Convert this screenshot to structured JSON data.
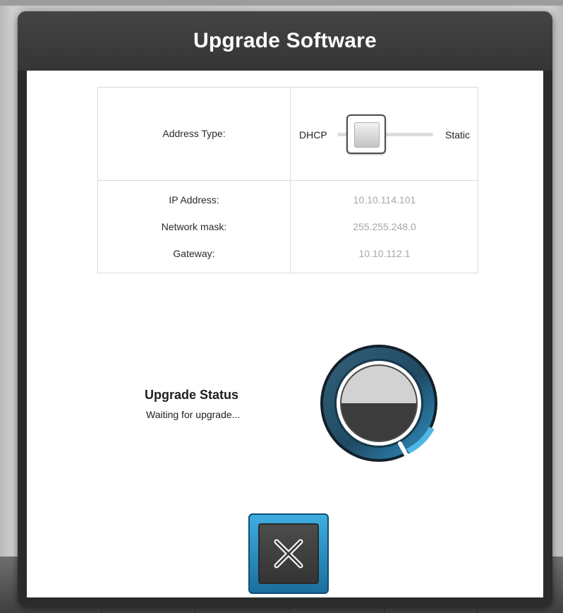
{
  "dialog": {
    "title": "Upgrade Software"
  },
  "network": {
    "address_type_label": "Address Type:",
    "toggle": {
      "left_option": "DHCP",
      "right_option": "Static",
      "selected": "DHCP"
    },
    "rows": [
      {
        "label": "IP Address:",
        "value": "10.10.114.101"
      },
      {
        "label": "Network mask:",
        "value": "255.255.248.0"
      },
      {
        "label": "Gateway:",
        "value": "10.10.112.1"
      }
    ]
  },
  "upgrade_status": {
    "title": "Upgrade Status",
    "message": "Waiting for upgrade..."
  },
  "actions": {
    "close_icon": "close-x-icon"
  },
  "colors": {
    "accent": "#2a8cc4",
    "header": "#3a3a3a",
    "value_text": "#a8a8a8"
  }
}
